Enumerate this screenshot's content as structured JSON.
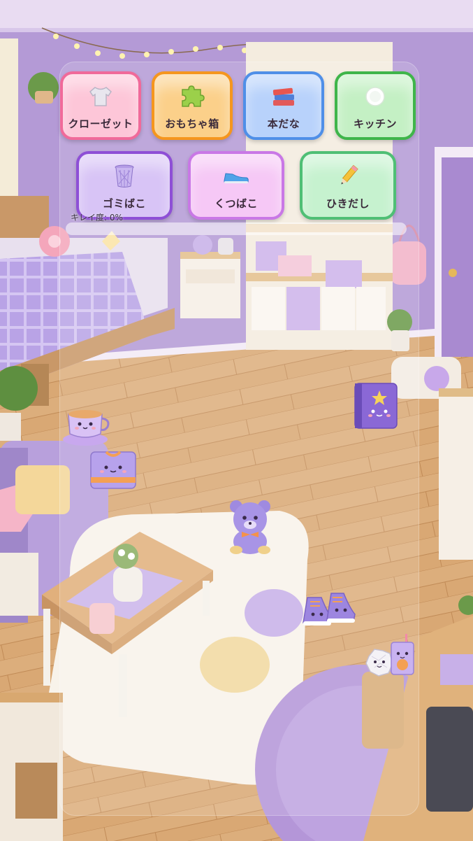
{
  "categories": [
    {
      "label": "クローゼット",
      "icon": "shirt-icon"
    },
    {
      "label": "おもちゃ箱",
      "icon": "puzzle-piece-icon"
    },
    {
      "label": "本だな",
      "icon": "books-icon"
    },
    {
      "label": "キッチン",
      "icon": "plate-icon"
    },
    {
      "label": "ゴミばこ",
      "icon": "trash-bin-icon"
    },
    {
      "label": "くつばこ",
      "icon": "sneaker-icon"
    },
    {
      "label": "ひきだし",
      "icon": "pencil-icon"
    }
  ],
  "cleanliness": {
    "label": "キレイ度: 0%",
    "value": 0
  },
  "colors": {
    "closet": "#f06a9a",
    "toy_box": "#f5961e",
    "bookshelf": "#4f8fe8",
    "kitchen": "#3fb54a",
    "trash": "#8e4fd6",
    "shoe_box": "#c978e6",
    "drawer": "#4fbf75"
  },
  "items": [
    {
      "name": "teacup-character",
      "icon": "teacup-icon"
    },
    {
      "name": "folded-shirt-character",
      "icon": "shirt-icon"
    },
    {
      "name": "storybook-character",
      "icon": "book-icon"
    },
    {
      "name": "teddy-bear-character",
      "icon": "teddy-bear-icon"
    },
    {
      "name": "sneakers-character",
      "icon": "sneaker-icon"
    },
    {
      "name": "crumpled-paper-character",
      "icon": "paper-ball-icon"
    },
    {
      "name": "juice-box-character",
      "icon": "juice-box-icon"
    }
  ]
}
